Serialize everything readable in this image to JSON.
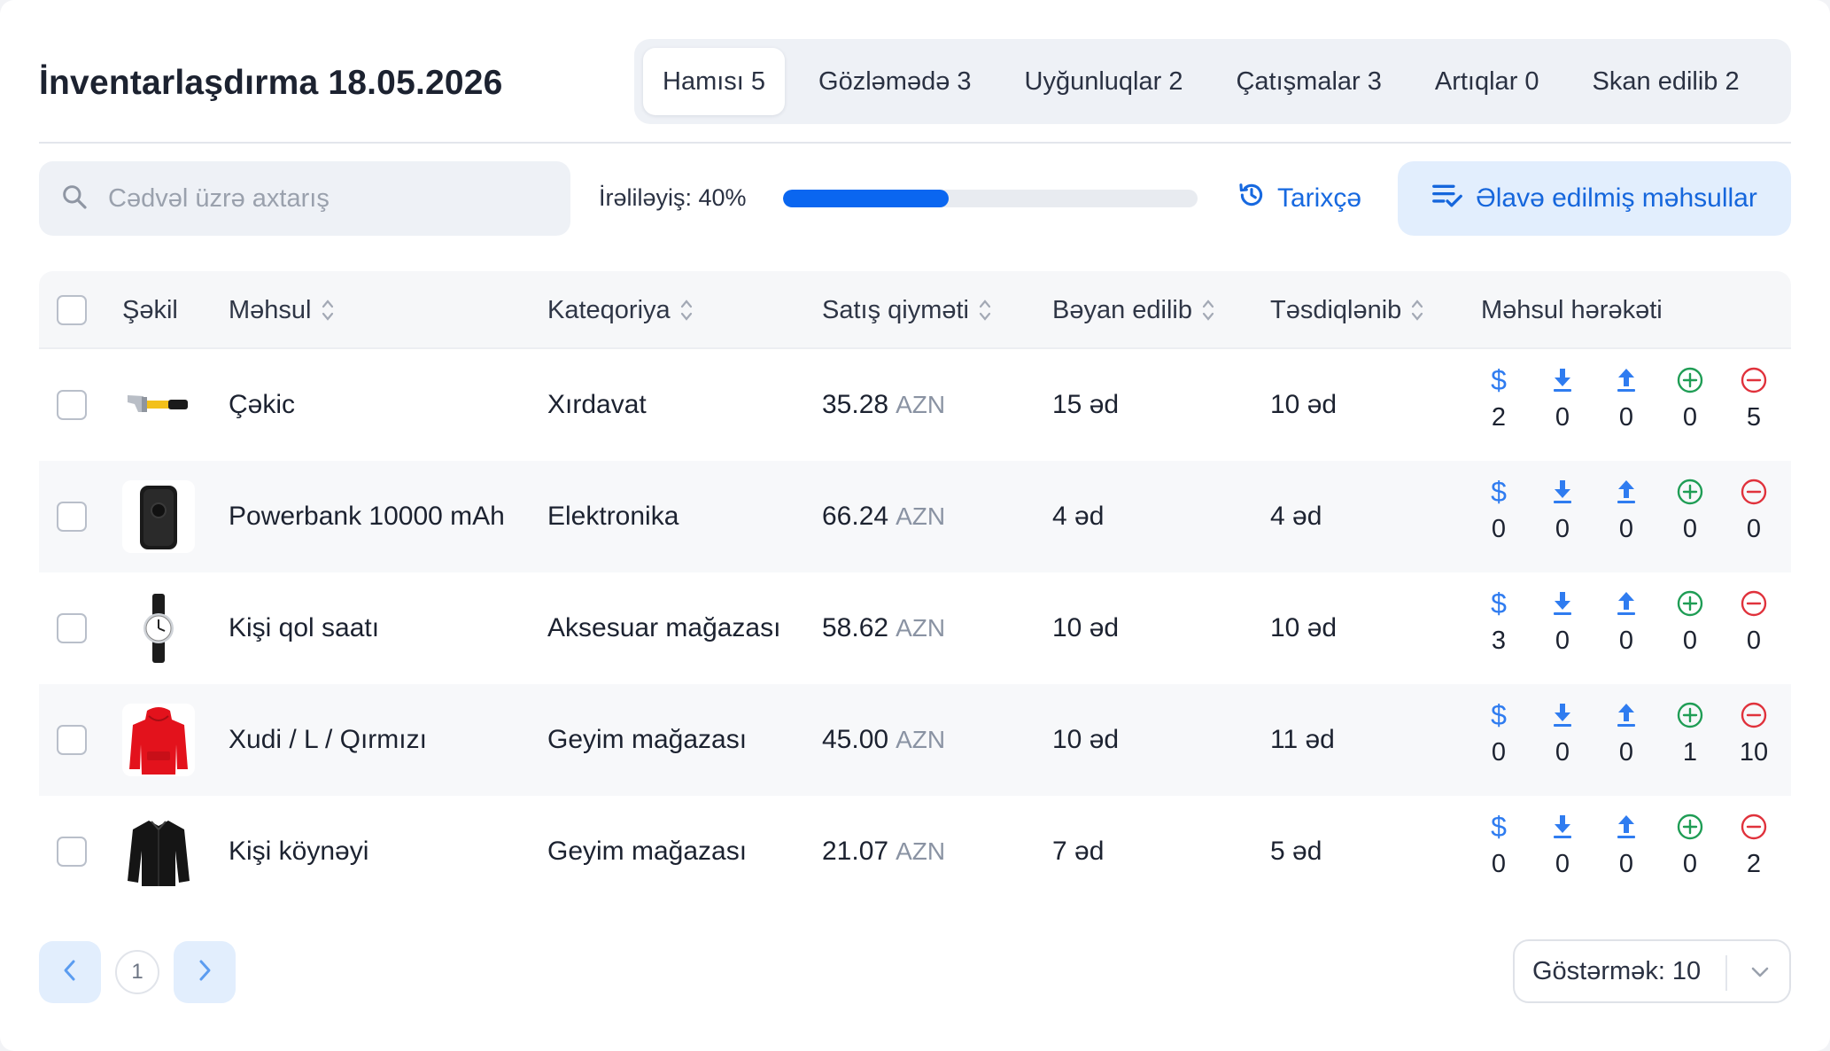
{
  "header": {
    "title": "İnventarlaşdırma 18.05.2026"
  },
  "tabs": [
    {
      "label": "Hamısı 5",
      "active": true
    },
    {
      "label": "Gözləmədə 3",
      "active": false
    },
    {
      "label": "Uyğunluqlar 2",
      "active": false
    },
    {
      "label": "Çatışmalar 3",
      "active": false
    },
    {
      "label": "Artıqlar 0",
      "active": false
    },
    {
      "label": "Skan edilib 2",
      "active": false
    }
  ],
  "toolbar": {
    "search_placeholder": "Cədvəl üzrə axtarış",
    "search_value": "",
    "progress_label": "İrəliləyiş: 40%",
    "progress_value": 0.4,
    "history_label": "Tarixçə",
    "added_products_label": "Əlavə edilmiş məhsullar"
  },
  "table": {
    "columns": {
      "image": "Şəkil",
      "product": "Məhsul",
      "category": "Kateqoriya",
      "price": "Satış qiyməti",
      "declared": "Bəyan edilib",
      "confirmed": "Təsdiqlənib",
      "movement": "Məhsul hərəkəti"
    },
    "rows": [
      {
        "image": "hammer",
        "product": "Çəkic",
        "category": "Xırdavat",
        "price": "35.28",
        "currency": "AZN",
        "declared": "15 əd",
        "confirmed": "10 əd",
        "movement": {
          "sale": "2",
          "import": "0",
          "export": "0",
          "surplus": "0",
          "shortage": "5"
        }
      },
      {
        "image": "powerbank",
        "product": "Powerbank 10000 mAh",
        "category": "Elektronika",
        "price": "66.24",
        "currency": "AZN",
        "declared": "4 əd",
        "confirmed": "4 əd",
        "movement": {
          "sale": "0",
          "import": "0",
          "export": "0",
          "surplus": "0",
          "shortage": "0"
        }
      },
      {
        "image": "watch",
        "product": "Kişi qol saatı",
        "category": "Aksesuar mağazası",
        "price": "58.62",
        "currency": "AZN",
        "declared": "10 əd",
        "confirmed": "10 əd",
        "movement": {
          "sale": "3",
          "import": "0",
          "export": "0",
          "surplus": "0",
          "shortage": "0"
        }
      },
      {
        "image": "hoodie",
        "product": "Xudi / L / Qırmızı",
        "category": "Geyim mağazası",
        "price": "45.00",
        "currency": "AZN",
        "declared": "10 əd",
        "confirmed": "11 əd",
        "movement": {
          "sale": "0",
          "import": "0",
          "export": "0",
          "surplus": "1",
          "shortage": "10"
        }
      },
      {
        "image": "shirt",
        "product": "Kişi köynəyi",
        "category": "Geyim mağazası",
        "price": "21.07",
        "currency": "AZN",
        "declared": "7 əd",
        "confirmed": "5 əd",
        "movement": {
          "sale": "0",
          "import": "0",
          "export": "0",
          "surplus": "0",
          "shortage": "2"
        }
      }
    ]
  },
  "pagination": {
    "current_page": "1",
    "per_page_label": "Göstərmək: 10"
  },
  "colors": {
    "accent": "#1769e0",
    "progress": "#0a66f0",
    "surplus": "#1f9d55",
    "shortage": "#e0323c",
    "tab_bg": "#eef1f6"
  },
  "icons": {
    "search": "search-icon",
    "history": "history-icon",
    "added": "list-check-icon",
    "sale": "dollar-icon",
    "import": "download-icon",
    "export": "upload-icon",
    "surplus": "plus-circle-icon",
    "shortage": "minus-circle-icon"
  }
}
